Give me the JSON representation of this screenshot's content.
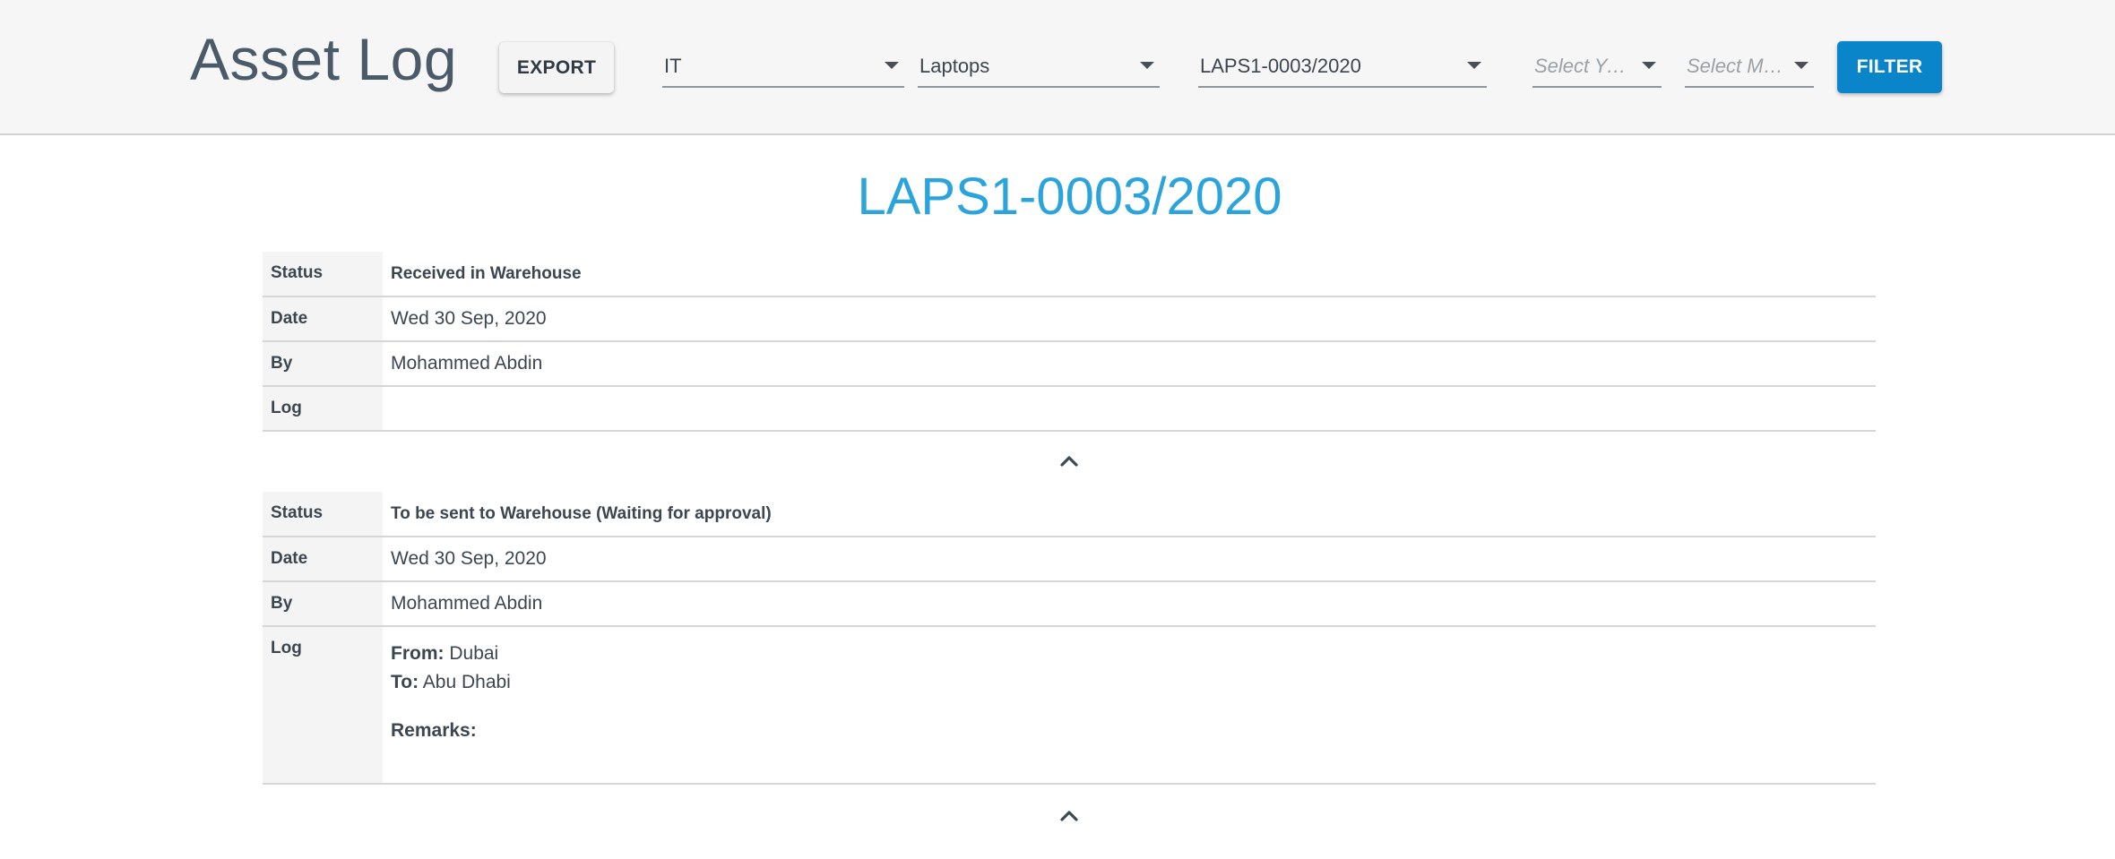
{
  "header": {
    "title": "Asset Log",
    "export_label": "EXPORT",
    "department": "IT",
    "category": "Laptops",
    "asset": "LAPS1-0003/2020",
    "year_placeholder": "Select Year",
    "month_placeholder": "Select Mo...",
    "filter_label": "FILTER",
    "accent_color": "#0a85c9"
  },
  "main": {
    "asset_title": "LAPS1-0003/2020",
    "title_color": "#2aa4db",
    "labels": {
      "status": "Status",
      "date": "Date",
      "by": "By",
      "log": "Log"
    },
    "entries": [
      {
        "status": "Received in Warehouse",
        "date": "Wed 30 Sep, 2020",
        "by": "Mohammed Abdin",
        "log": ""
      },
      {
        "status": "To be sent to Warehouse (Waiting for approval)",
        "date": "Wed 30 Sep, 2020",
        "by": "Mohammed Abdin",
        "log": {
          "from_label": "From:",
          "from": "Dubai",
          "to_label": "To:",
          "to": "Abu Dhabi",
          "remarks_label": "Remarks:",
          "remarks": ""
        }
      }
    ],
    "collapse_icon": "chevron-up-icon"
  }
}
